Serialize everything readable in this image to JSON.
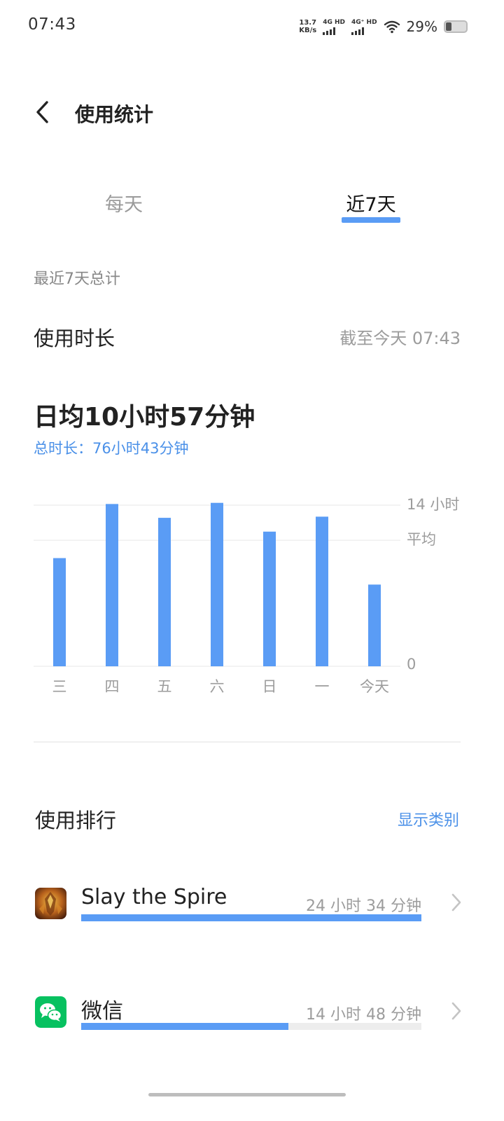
{
  "status_bar": {
    "time": "07:43",
    "net_speed_value": "13.7",
    "net_speed_unit": "KB/s",
    "sim1_label": "4G HD",
    "sim2_label": "4G⁺ HD",
    "battery_percent_text": "29%",
    "battery_level": 0.29
  },
  "header": {
    "title": "使用统计"
  },
  "tabs": {
    "daily": "每天",
    "week": "近7天",
    "active": "week"
  },
  "summary": {
    "caption": "最近7天总计",
    "usage_label": "使用时长",
    "as_of": "截至今天 07:43",
    "daily_average": "日均10小时57分钟",
    "total": "总时长：76小时43分钟"
  },
  "chart_data": {
    "type": "bar",
    "categories": [
      "三",
      "四",
      "五",
      "六",
      "日",
      "一",
      "今天"
    ],
    "values": [
      9.4,
      14.1,
      12.9,
      14.2,
      11.7,
      13.0,
      7.1
    ],
    "ylim": [
      0,
      14
    ],
    "y_tick_labels": {
      "max": "14 小时",
      "average": "平均",
      "zero": "0"
    },
    "average_hours": 10.95,
    "y_unit": "小时",
    "bar_color": "#5a9cf5",
    "grid": true
  },
  "ranking": {
    "title": "使用排行",
    "show_categories": "显示类别",
    "apps": [
      {
        "name": "Slay the Spire",
        "duration": "24 小时 34 分钟",
        "icon": "slay-the-spire-icon",
        "share": 1.0
      },
      {
        "name": "微信",
        "duration": "14 小时 48 分钟",
        "icon": "wechat-icon",
        "share": 0.61
      }
    ]
  },
  "colors": {
    "accent": "#5a9cf5",
    "link": "#4a90e8",
    "wechat_green": "#07c160"
  }
}
